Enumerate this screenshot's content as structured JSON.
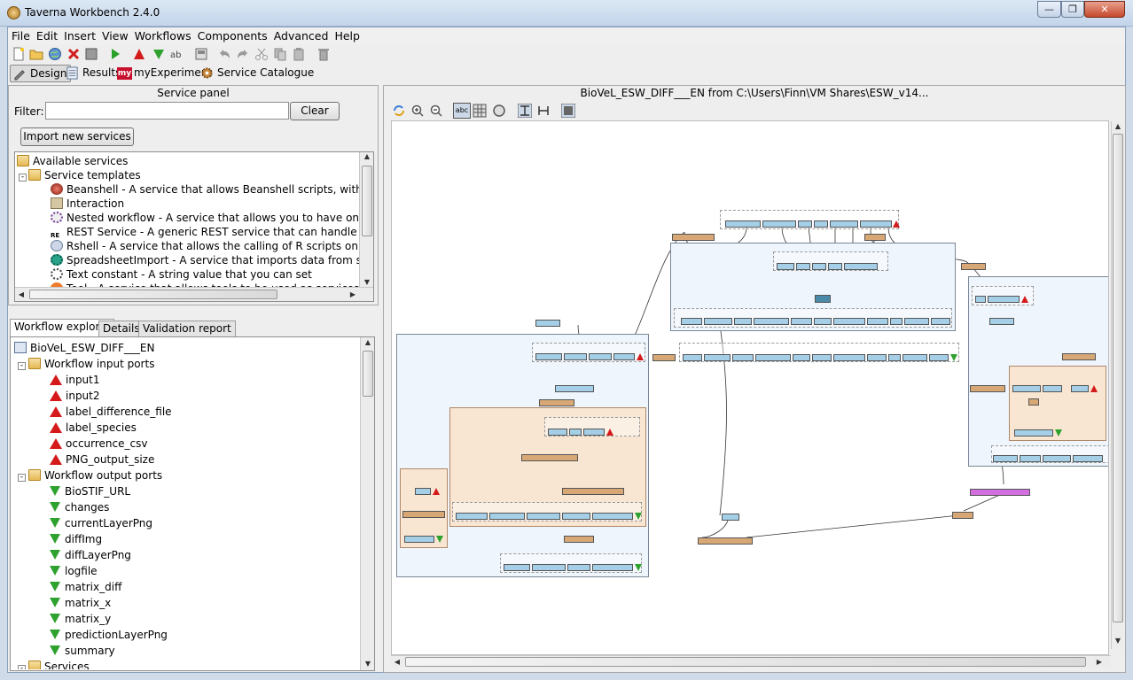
{
  "window": {
    "title": "Taverna Workbench 2.4.0",
    "min": "—",
    "max": "❐",
    "close": "✕"
  },
  "menu": [
    "File",
    "Edit",
    "Insert",
    "View",
    "Workflows",
    "Components",
    "Advanced",
    "Help"
  ],
  "perspectives": {
    "design": "Design",
    "results": "Results",
    "myexperiment": "myExperiment",
    "my_badge": "my",
    "catalogue": "Service Catalogue"
  },
  "service_panel": {
    "title": "Service panel",
    "filter_label": "Filter:",
    "filter_value": "",
    "clear": "Clear",
    "import": "Import new services",
    "tree": [
      {
        "label": "Available services"
      },
      {
        "label": "Service templates"
      },
      {
        "label": "Beanshell - A service that allows Beanshell scripts, with dependencies"
      },
      {
        "label": "Interaction"
      },
      {
        "label": "Nested workflow - A service that allows you to have one workflow ne"
      },
      {
        "label": "REST Service - A generic REST service that can handle all HTTP meth"
      },
      {
        "label": "Rshell - A service that allows the calling of R scripts on an R server"
      },
      {
        "label": "SpreadsheetImport - A service that imports data from spreadsheets"
      },
      {
        "label": "Text constant - A string value that you can set"
      },
      {
        "label": "Tool - A service that allows tools to be used as services"
      }
    ]
  },
  "tabs": [
    "Workflow explorer",
    "Details",
    "Validation report"
  ],
  "explorer": {
    "root": "BioVeL_ESW_DIFF___EN",
    "inputs_label": "Workflow input ports",
    "inputs": [
      "input1",
      "input2",
      "label_difference_file",
      "label_species",
      "occurrence_csv",
      "PNG_output_size"
    ],
    "outputs_label": "Workflow output ports",
    "outputs": [
      "BioSTIF_URL",
      "changes",
      "currentLayerPng",
      "diffImg",
      "diffLayerPng",
      "logfile",
      "matrix_diff",
      "matrix_x",
      "matrix_y",
      "predictionLayerPng",
      "summary"
    ],
    "services_label": "Services"
  },
  "diagram": {
    "title": "BioVeL_ESW_DIFF___EN from C:\\Users\\Finn\\VM Shares\\ESW_v14...",
    "toolbar_abc": "abc"
  },
  "colors": {
    "accent": "#6b93c0",
    "port_in": "#d41a1a",
    "port_out": "#2fa12f",
    "node_blue": "#a4cfe7",
    "node_tan": "#d7a876",
    "node_purple": "#d36ee0"
  }
}
